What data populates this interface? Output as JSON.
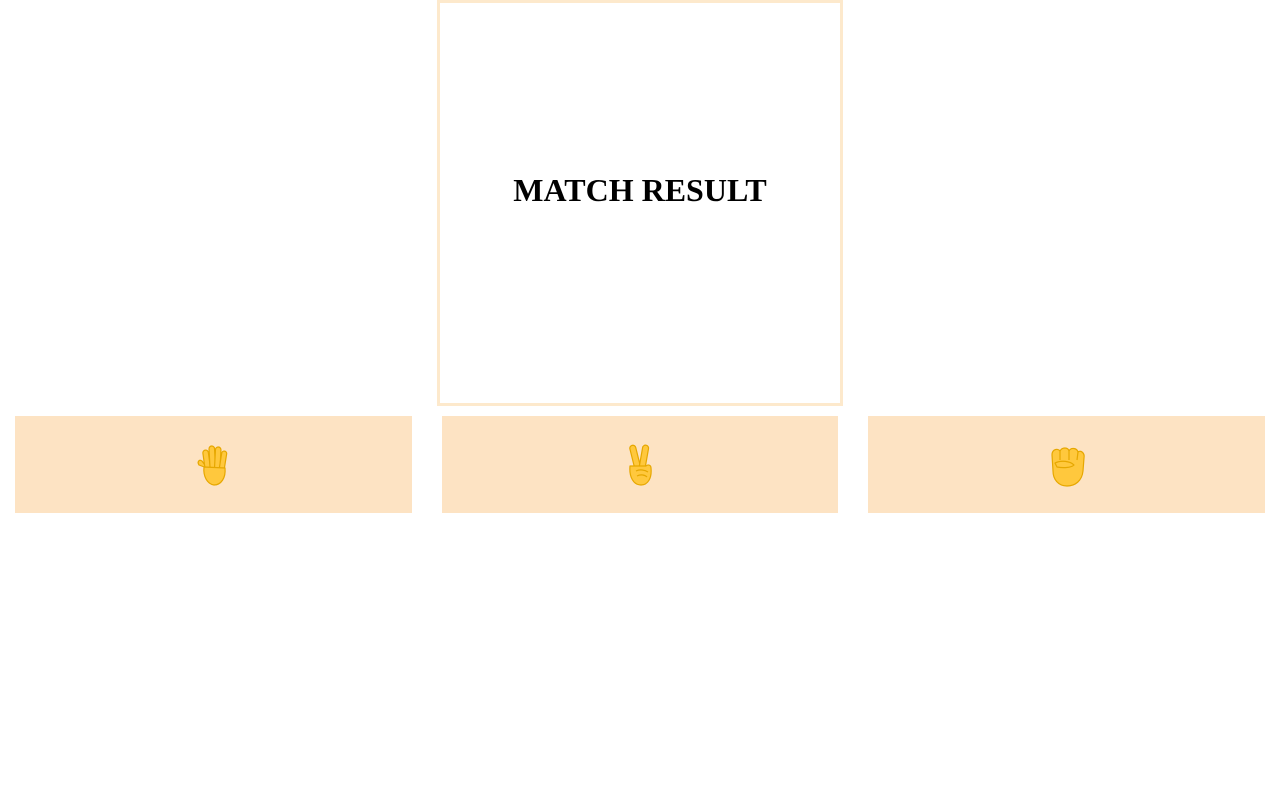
{
  "result": {
    "title": "MATCH RESULT"
  },
  "choices": [
    {
      "name": "paper",
      "icon": "raised-hand-icon"
    },
    {
      "name": "scissors",
      "icon": "victory-hand-icon"
    },
    {
      "name": "rock",
      "icon": "raised-fist-icon"
    }
  ],
  "colors": {
    "result_border": "#fde9cc",
    "button_bg": "#fde3c3",
    "hand_fill": "#ffc83d",
    "hand_stroke": "#e6a700"
  }
}
